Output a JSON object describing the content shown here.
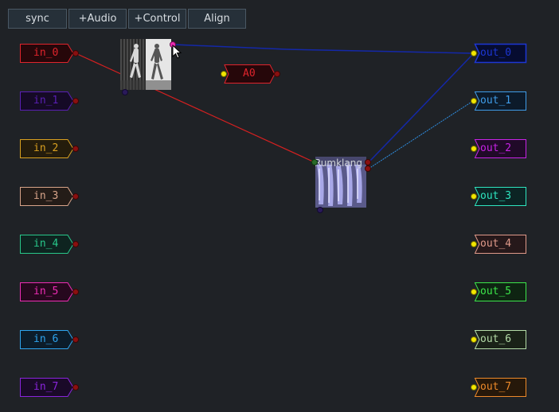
{
  "toolbar": {
    "sync_label": "sync",
    "audio_label": "+Audio",
    "control_label": "+Control",
    "align_label": "Align"
  },
  "inputs": [
    {
      "label": "in_0",
      "color": "#e0242c"
    },
    {
      "label": "in_1",
      "color": "#5a1fb4"
    },
    {
      "label": "in_2",
      "color": "#d9a020"
    },
    {
      "label": "in_3",
      "color": "#d8a48a"
    },
    {
      "label": "in_4",
      "color": "#28c88a"
    },
    {
      "label": "in_5",
      "color": "#ee2cb4"
    },
    {
      "label": "in_6",
      "color": "#2ea4ee"
    },
    {
      "label": "in_7",
      "color": "#8a24dc"
    }
  ],
  "outputs": [
    {
      "label": "out_0",
      "color": "#1c36d4"
    },
    {
      "label": "out_1",
      "color": "#3f9ce8"
    },
    {
      "label": "out_2",
      "color": "#c823e6"
    },
    {
      "label": "out_3",
      "color": "#2ee6c0"
    },
    {
      "label": "out_4",
      "color": "#e09a8a"
    },
    {
      "label": "out_5",
      "color": "#3ce64a"
    },
    {
      "label": "out_6",
      "color": "#b4dca8"
    },
    {
      "label": "out_7",
      "color": "#ee8a2a"
    }
  ],
  "control_node": {
    "label": "A0",
    "color": "#e0242c"
  },
  "effect_node": {
    "title": "Rumklang"
  },
  "colors": {
    "background": "#1f2226",
    "wire_red": "#d62020",
    "wire_blue": "#1428a8",
    "wire_lightblue": "#2e8ee0",
    "port_yellow": "#f2e600",
    "port_darkred": "#8a1010",
    "port_purple": "#2a1a5a"
  }
}
